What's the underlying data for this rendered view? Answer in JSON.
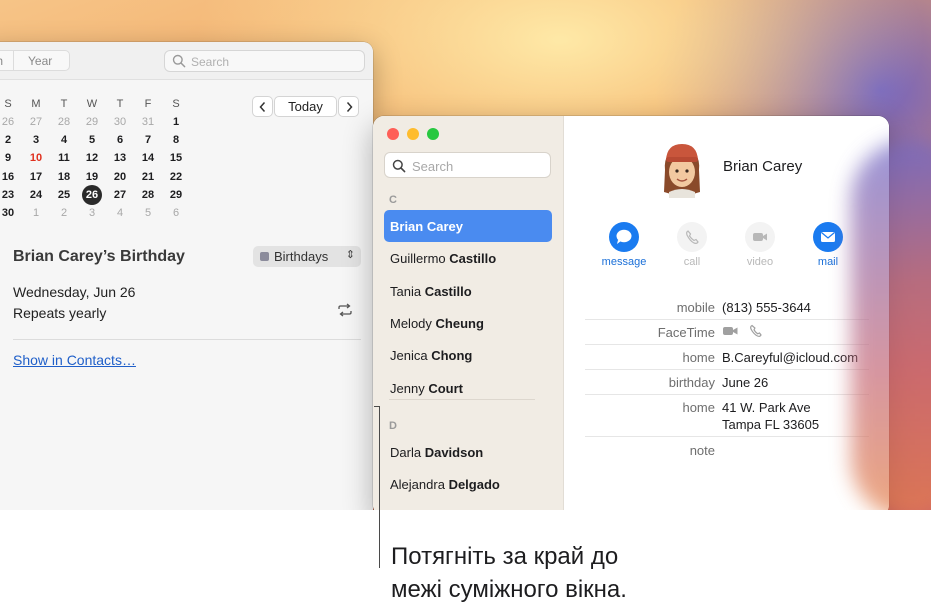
{
  "calendar": {
    "view_tabs": [
      "th",
      "Year"
    ],
    "search_placeholder": "Search",
    "weekdays": [
      "S",
      "M",
      "T",
      "W",
      "T",
      "F",
      "S"
    ],
    "weeks": [
      [
        "26",
        "27",
        "28",
        "29",
        "30",
        "31",
        "1"
      ],
      [
        "2",
        "3",
        "4",
        "5",
        "6",
        "7",
        "8"
      ],
      [
        "9",
        "10",
        "11",
        "12",
        "13",
        "14",
        "15"
      ],
      [
        "16",
        "17",
        "18",
        "19",
        "20",
        "21",
        "22"
      ],
      [
        "23",
        "24",
        "25",
        "26",
        "27",
        "28",
        "29"
      ],
      [
        "30",
        "1",
        "2",
        "3",
        "4",
        "5",
        "6"
      ]
    ],
    "today_label": "Today",
    "prev_icon": "chevron-left-icon",
    "next_icon": "chevron-right-icon",
    "event": {
      "title": "Brian Carey’s Birthday",
      "calendar_name": "Birthdays",
      "date": "Wednesday, Jun 26",
      "repeat": "Repeats yearly",
      "show_link": "Show in Contacts…"
    }
  },
  "contacts": {
    "search_placeholder": "Search",
    "sections": [
      {
        "letter": "C",
        "items": [
          {
            "first": "Brian",
            "last": "Carey",
            "selected": true
          },
          {
            "first": "Guillermo",
            "last": "Castillo"
          },
          {
            "first": "Tania",
            "last": "Castillo"
          },
          {
            "first": "Melody",
            "last": "Cheung"
          },
          {
            "first": "Jenica",
            "last": "Chong"
          },
          {
            "first": "Jenny",
            "last": "Court"
          }
        ]
      },
      {
        "letter": "D",
        "items": [
          {
            "first": "Darla",
            "last": "Davidson"
          },
          {
            "first": "Alejandra",
            "last": "Delgado"
          }
        ]
      }
    ],
    "card": {
      "name": "Brian Carey",
      "actions": [
        {
          "label": "message",
          "icon": "message-bubble-icon",
          "enabled": true
        },
        {
          "label": "call",
          "icon": "phone-icon",
          "enabled": false
        },
        {
          "label": "video",
          "icon": "video-camera-icon",
          "enabled": false
        },
        {
          "label": "mail",
          "icon": "envelope-icon",
          "enabled": true
        }
      ],
      "fields": [
        {
          "label": "mobile",
          "value": "(813) 555-3644"
        },
        {
          "label": "FaceTime",
          "value": ""
        },
        {
          "label": "home",
          "value": "B.Careyful@icloud.com"
        },
        {
          "label": "birthday",
          "value": "June 26"
        },
        {
          "label": "home",
          "value": "41 W. Park Ave",
          "value2": "Tampa FL 33605"
        },
        {
          "label": "note",
          "value": ""
        }
      ]
    }
  },
  "caption": {
    "line1": "Потягніть за край до",
    "line2": "межі суміжного вікна."
  },
  "colors": {
    "accent": "#1a7bf0",
    "selection": "#4a8bf0",
    "today_red": "#e0301e",
    "link": "#1f5fc9"
  }
}
